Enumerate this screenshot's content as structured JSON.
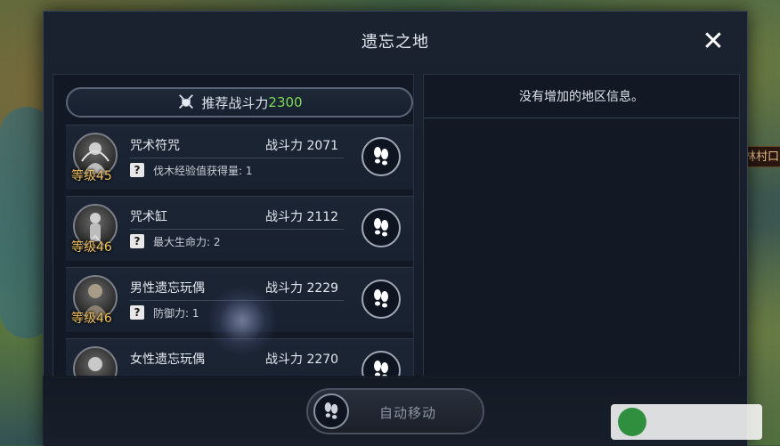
{
  "dialog": {
    "title": "遗忘之地",
    "close_symbol": "✕"
  },
  "recommend": {
    "label": "推荐战斗力",
    "value": "2300"
  },
  "region_info": "没有增加的地区信息。",
  "map_label": "林村口",
  "monsters": [
    {
      "name": "咒术符咒",
      "level": "等级45",
      "power": "战斗力 2071",
      "buff": "伐木经验值获得量: 1",
      "buff_icon": "?"
    },
    {
      "name": "咒术缸",
      "level": "等级46",
      "power": "战斗力 2112",
      "buff": "最大生命力: 2",
      "buff_icon": "?"
    },
    {
      "name": "男性遗忘玩偶",
      "level": "等级46",
      "power": "战斗力 2229",
      "buff": "防御力: 1",
      "buff_icon": "?"
    },
    {
      "name": "女性遗忘玩偶",
      "level": "",
      "power": "战斗力 2270",
      "buff": "",
      "buff_icon": ""
    }
  ],
  "auto_move": {
    "label": "自动移动"
  },
  "icons": {
    "close": "close-icon",
    "shield": "crossed-swords-shield-icon",
    "footprints": "footprints-icon",
    "question": "question-icon"
  },
  "colors": {
    "power_value": "#7ed957",
    "level": "#f0c15a"
  }
}
